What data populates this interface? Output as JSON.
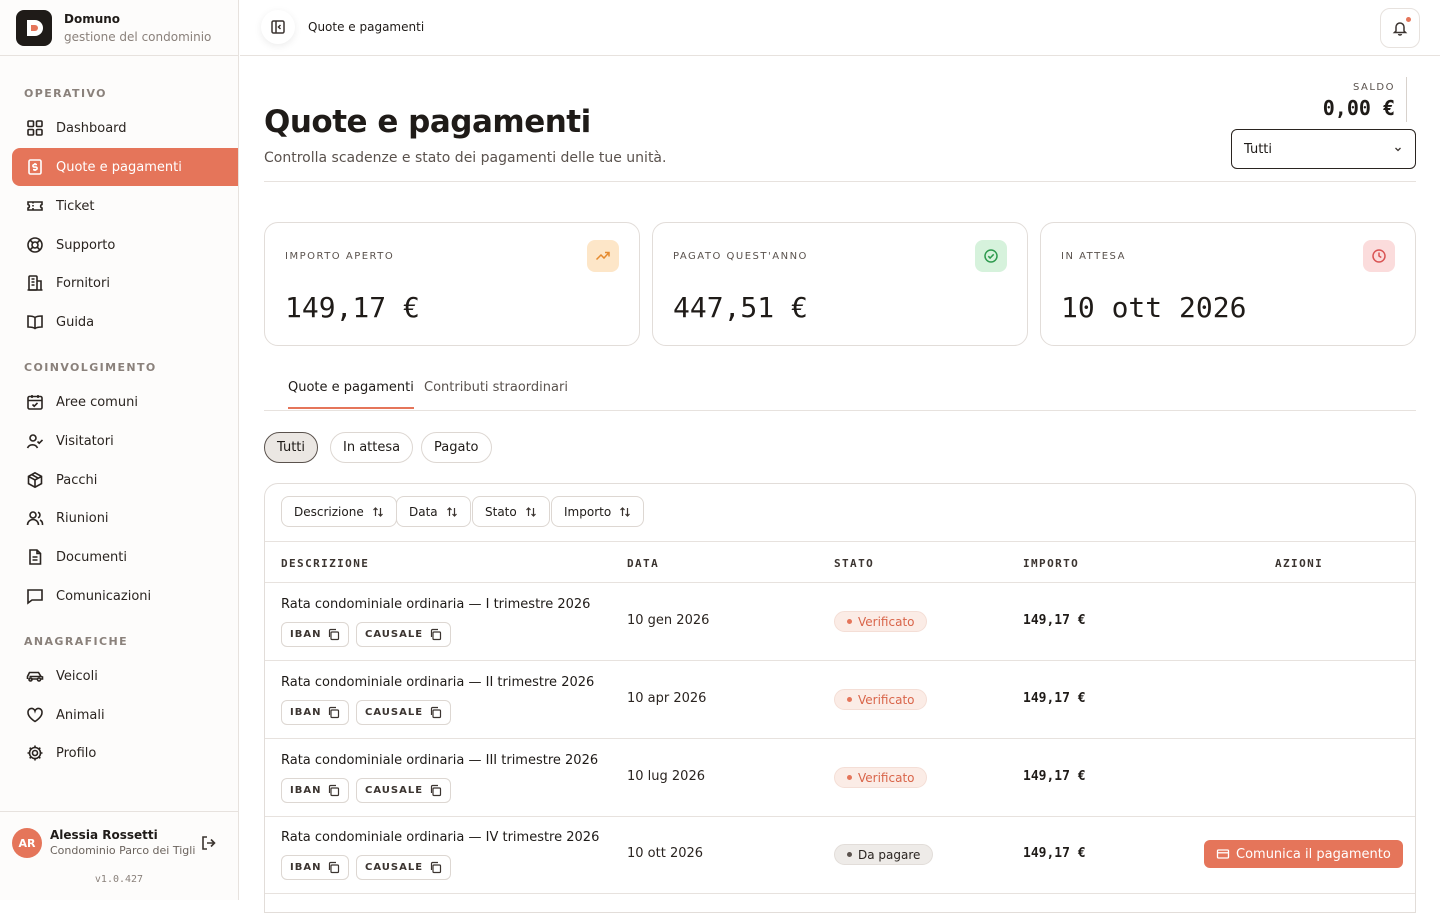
{
  "brand": {
    "name": "Domuno",
    "subtitle": "gestione del condominio"
  },
  "sidebar": {
    "sections": [
      {
        "title": "OPERATIVO",
        "items": [
          {
            "label": "Dashboard",
            "icon": "dashboard-grid-icon"
          },
          {
            "label": "Quote e pagamenti",
            "icon": "receipt-dollar-icon",
            "active": true
          },
          {
            "label": "Ticket",
            "icon": "ticket-icon"
          },
          {
            "label": "Supporto",
            "icon": "lifebuoy-icon"
          },
          {
            "label": "Fornitori",
            "icon": "building-icon"
          },
          {
            "label": "Guida",
            "icon": "book-icon"
          }
        ]
      },
      {
        "title": "COINVOLGIMENTO",
        "items": [
          {
            "label": "Aree comuni",
            "icon": "calendar-icon"
          },
          {
            "label": "Visitatori",
            "icon": "user-check-icon"
          },
          {
            "label": "Pacchi",
            "icon": "package-icon"
          },
          {
            "label": "Riunioni",
            "icon": "users-icon"
          },
          {
            "label": "Documenti",
            "icon": "document-icon"
          },
          {
            "label": "Comunicazioni",
            "icon": "message-icon"
          }
        ]
      },
      {
        "title": "ANAGRAFICHE",
        "items": [
          {
            "label": "Veicoli",
            "icon": "car-icon"
          },
          {
            "label": "Animali",
            "icon": "heart-icon"
          },
          {
            "label": "Profilo",
            "icon": "gear-icon"
          }
        ]
      }
    ]
  },
  "user": {
    "initials": "AR",
    "name": "Alessia Rossetti",
    "building": "Condominio Parco dei Tigli",
    "version": "v1.0.427"
  },
  "topbar": {
    "breadcrumb": "Quote e pagamenti"
  },
  "page": {
    "title": "Quote e pagamenti",
    "subtitle": "Controlla scadenze e stato dei pagamenti delle tue unità.",
    "saldo_label": "SALDO",
    "saldo_value": "0,00 €",
    "filter_select": "Tutti"
  },
  "cards": [
    {
      "label": "IMPORTO APERTO",
      "value": "149,17 €",
      "icon": "trending-up-icon",
      "color": "#fde6c8",
      "stroke": "#e58a2e"
    },
    {
      "label": "PAGATO QUEST'ANNO",
      "value": "447,51 €",
      "icon": "check-circle-icon",
      "color": "#d6f2dc",
      "stroke": "#2e9a4e"
    },
    {
      "label": "IN ATTESA",
      "value": "10 ott 2026",
      "icon": "clock-icon",
      "color": "#fbdcdc",
      "stroke": "#d95454"
    }
  ],
  "tabs": [
    {
      "label": "Quote e pagamenti",
      "active": true
    },
    {
      "label": "Contributi straordinari",
      "active": false
    }
  ],
  "chips": [
    {
      "label": "Tutti",
      "active": true
    },
    {
      "label": "In attesa",
      "active": false
    },
    {
      "label": "Pagato",
      "active": false
    }
  ],
  "sort_buttons": [
    "Descrizione",
    "Data",
    "Stato",
    "Importo"
  ],
  "table": {
    "headers": [
      "DESCRIZIONE",
      "DATA",
      "STATO",
      "IMPORTO",
      "AZIONI"
    ],
    "iban_label": "IBAN",
    "causale_label": "CAUSALE",
    "rows": [
      {
        "description": "Rata condominiale ordinaria — I trimestre 2026",
        "date": "10 gen 2026",
        "status": "Verificato",
        "status_kind": "ok",
        "amount": "149,17 €",
        "action": ""
      },
      {
        "description": "Rata condominiale ordinaria — II trimestre 2026",
        "date": "10 apr 2026",
        "status": "Verificato",
        "status_kind": "ok",
        "amount": "149,17 €",
        "action": ""
      },
      {
        "description": "Rata condominiale ordinaria — III trimestre 2026",
        "date": "10 lug 2026",
        "status": "Verificato",
        "status_kind": "ok",
        "amount": "149,17 €",
        "action": ""
      },
      {
        "description": "Rata condominiale ordinaria — IV trimestre 2026",
        "date": "10 ott 2026",
        "status": "Da pagare",
        "status_kind": "pending",
        "amount": "149,17 €",
        "action": "Comunica il pagamento"
      }
    ]
  },
  "colors": {
    "accent": "#e5755a",
    "text": "#1f1b18",
    "muted": "#8a817b"
  }
}
